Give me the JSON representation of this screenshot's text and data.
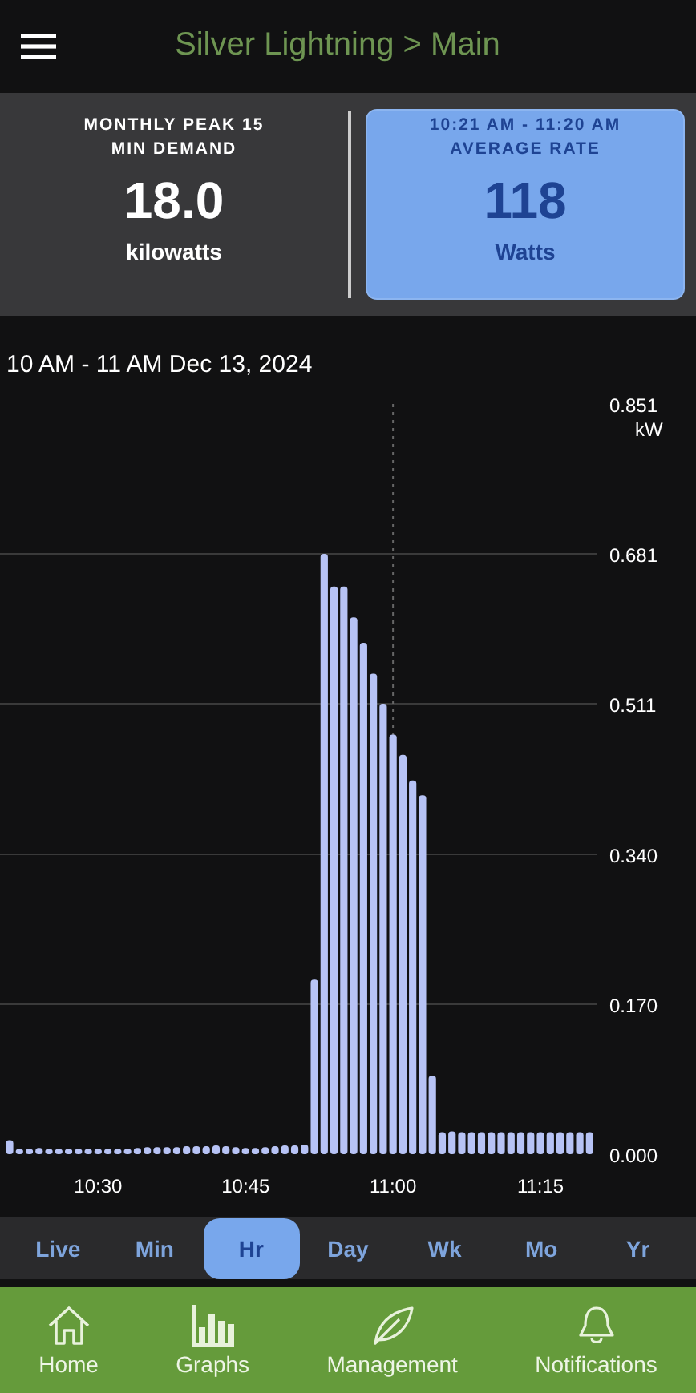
{
  "header": {
    "title": "Silver Lightning > Main"
  },
  "cards": [
    {
      "kind": "plain",
      "label": "MONTHLY PEAK 15 MIN DEMAND",
      "value": "18.0",
      "unit": "kilowatts",
      "selected": false
    },
    {
      "kind": "highlight",
      "sublabel": "10:21 AM - 11:20 AM",
      "label": "AVERAGE RATE",
      "value": "118",
      "unit": "Watts",
      "selected": true
    }
  ],
  "chart": {
    "title": "10 AM - 11 AM Dec 13, 2024",
    "chart_data": {
      "type": "bar",
      "ylabel": "kW",
      "ylim": [
        0,
        0.851
      ],
      "grid": true,
      "categories": [
        null,
        null,
        null,
        null,
        null,
        null,
        null,
        null,
        null,
        "10:30",
        null,
        null,
        null,
        null,
        null,
        null,
        null,
        null,
        null,
        null,
        null,
        null,
        null,
        null,
        "10:45",
        null,
        null,
        null,
        null,
        null,
        null,
        null,
        null,
        null,
        null,
        null,
        null,
        null,
        null,
        "11:00",
        null,
        null,
        null,
        null,
        null,
        null,
        null,
        null,
        null,
        null,
        null,
        null,
        null,
        null,
        "11:15",
        null,
        null,
        null,
        null,
        null
      ],
      "yticks": [
        {
          "value": 0,
          "label": "0.000"
        },
        {
          "value": 0.17,
          "label": "0.170"
        },
        {
          "value": 0.34,
          "label": "0.340"
        },
        {
          "value": 0.511,
          "label": "0.511"
        },
        {
          "value": 0.681,
          "label": "0.681"
        },
        {
          "value": 0.851,
          "label": "0.851"
        }
      ],
      "values": [
        0.016,
        0.006,
        0.006,
        0.007,
        0.006,
        0.006,
        0.006,
        0.006,
        0.006,
        0.006,
        0.006,
        0.006,
        0.006,
        0.007,
        0.008,
        0.008,
        0.008,
        0.008,
        0.009,
        0.009,
        0.009,
        0.01,
        0.009,
        0.008,
        0.007,
        0.007,
        0.008,
        0.009,
        0.01,
        0.01,
        0.011,
        0.198,
        0.681,
        0.644,
        0.644,
        0.609,
        0.58,
        0.545,
        0.511,
        0.476,
        0.453,
        0.424,
        0.407,
        0.089,
        0.025,
        0.026,
        0.025,
        0.025,
        0.025,
        0.025,
        0.025,
        0.025,
        0.025,
        0.025,
        0.025,
        0.025,
        0.025,
        0.025,
        0.025,
        0.025
      ]
    }
  },
  "ranges": [
    {
      "label": "Live",
      "selected": false
    },
    {
      "label": "Min",
      "selected": false
    },
    {
      "label": "Hr",
      "selected": true
    },
    {
      "label": "Day",
      "selected": false
    },
    {
      "label": "Wk",
      "selected": false
    },
    {
      "label": "Mo",
      "selected": false
    },
    {
      "label": "Yr",
      "selected": false
    }
  ],
  "nav": [
    {
      "kind": "home",
      "label": "Home"
    },
    {
      "kind": "graphs",
      "label": "Graphs"
    },
    {
      "kind": "leaf",
      "label": "Management"
    },
    {
      "kind": "bell",
      "label": "Notifications"
    }
  ]
}
